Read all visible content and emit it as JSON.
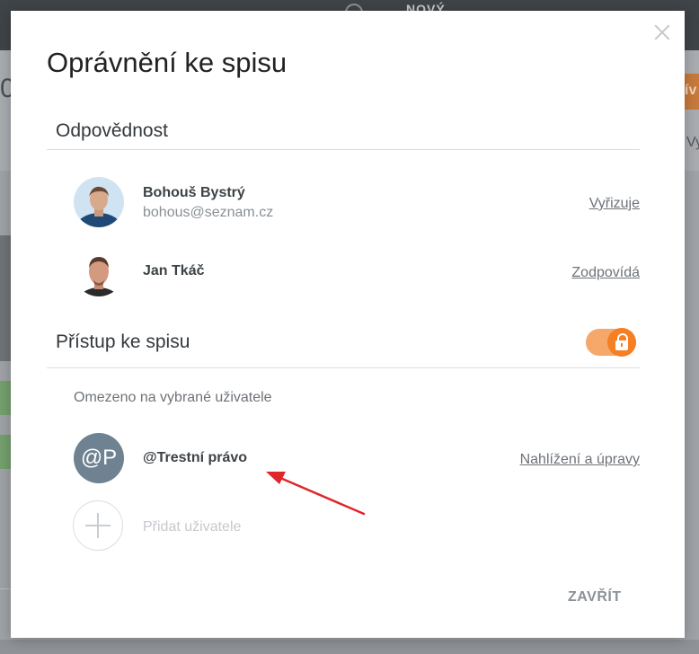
{
  "background": {
    "new_label": "NOVÝ",
    "counter_fragment": "0",
    "orange_fragment": "ív",
    "right_fragment": "Vy"
  },
  "modal": {
    "title": "Oprávnění ke spisu",
    "responsibility": {
      "heading": "Odpovědnost",
      "people": [
        {
          "name": "Bohouš Bystrý",
          "email": "bohous@seznam.cz",
          "role": "Vyřizuje"
        },
        {
          "name": "Jan Tkáč",
          "email": "",
          "role": "Zodpovídá"
        }
      ]
    },
    "access": {
      "heading": "Přístup ke spisu",
      "toggle_on": true,
      "toggle_icon": "lock-icon",
      "restricted_note": "Omezeno na vybrané uživatele",
      "entries": [
        {
          "avatar_initials": "@P",
          "name": "@Trestní právo",
          "permission": "Nahlížení a úpravy"
        }
      ],
      "add_user_label": "Přidat uživatele"
    },
    "close_button": "ZAVŘÍT"
  },
  "colors": {
    "accent_orange": "#f47f24",
    "annotation_arrow": "#e0262b",
    "group_avatar": "#6e8291"
  }
}
